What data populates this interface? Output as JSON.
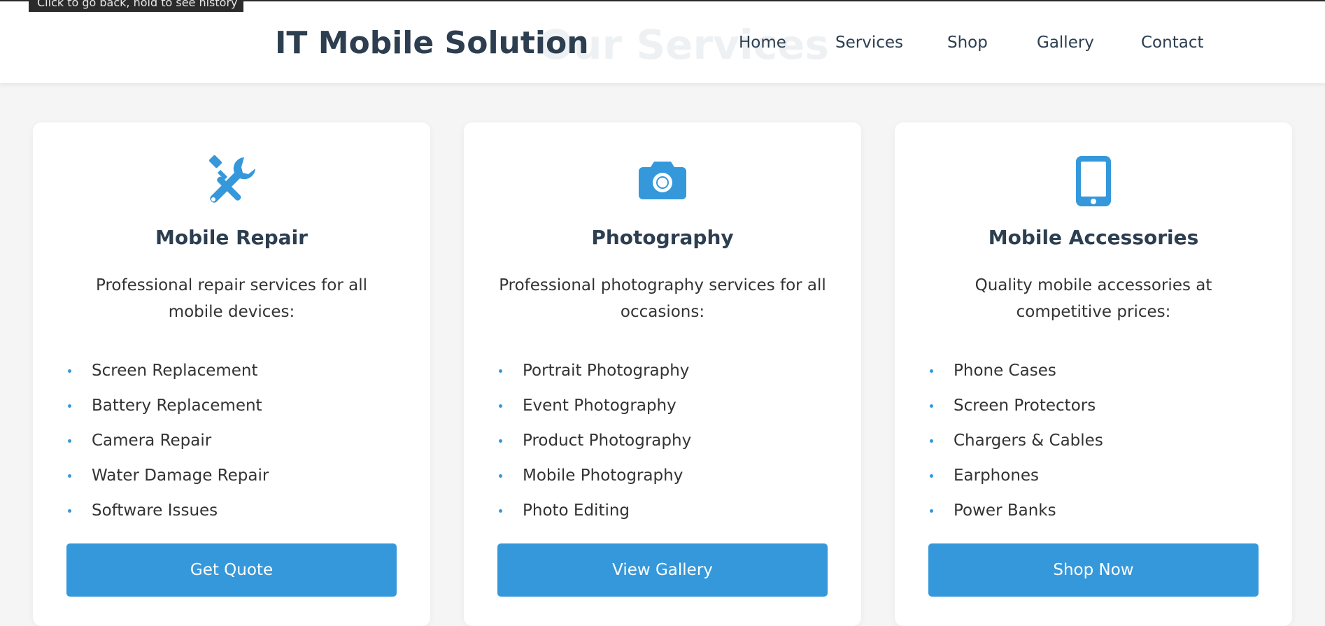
{
  "browser": {
    "tooltip": "Click to go back, hold to see history"
  },
  "header": {
    "logo": "IT Mobile Solution",
    "ghost_title": "Our Services",
    "nav": [
      {
        "label": "Home"
      },
      {
        "label": "Services"
      },
      {
        "label": "Shop"
      },
      {
        "label": "Gallery"
      },
      {
        "label": "Contact"
      }
    ]
  },
  "colors": {
    "accent": "#3498db",
    "heading": "#2c3e50",
    "page_background": "#f5f5f5"
  },
  "services": [
    {
      "icon": "tools-icon",
      "title": "Mobile Repair",
      "description": "Professional repair services for all mobile devices:",
      "items": [
        "Screen Replacement",
        "Battery Replacement",
        "Camera Repair",
        "Water Damage Repair",
        "Software Issues"
      ],
      "button": "Get Quote"
    },
    {
      "icon": "camera-icon",
      "title": "Photography",
      "description": "Professional photography services for all occasions:",
      "items": [
        "Portrait Photography",
        "Event Photography",
        "Product Photography",
        "Mobile Photography",
        "Photo Editing"
      ],
      "button": "View Gallery"
    },
    {
      "icon": "mobile-phone-icon",
      "title": "Mobile Accessories",
      "description": "Quality mobile accessories at competitive prices:",
      "items": [
        "Phone Cases",
        "Screen Protectors",
        "Chargers & Cables",
        "Earphones",
        "Power Banks"
      ],
      "button": "Shop Now"
    }
  ]
}
